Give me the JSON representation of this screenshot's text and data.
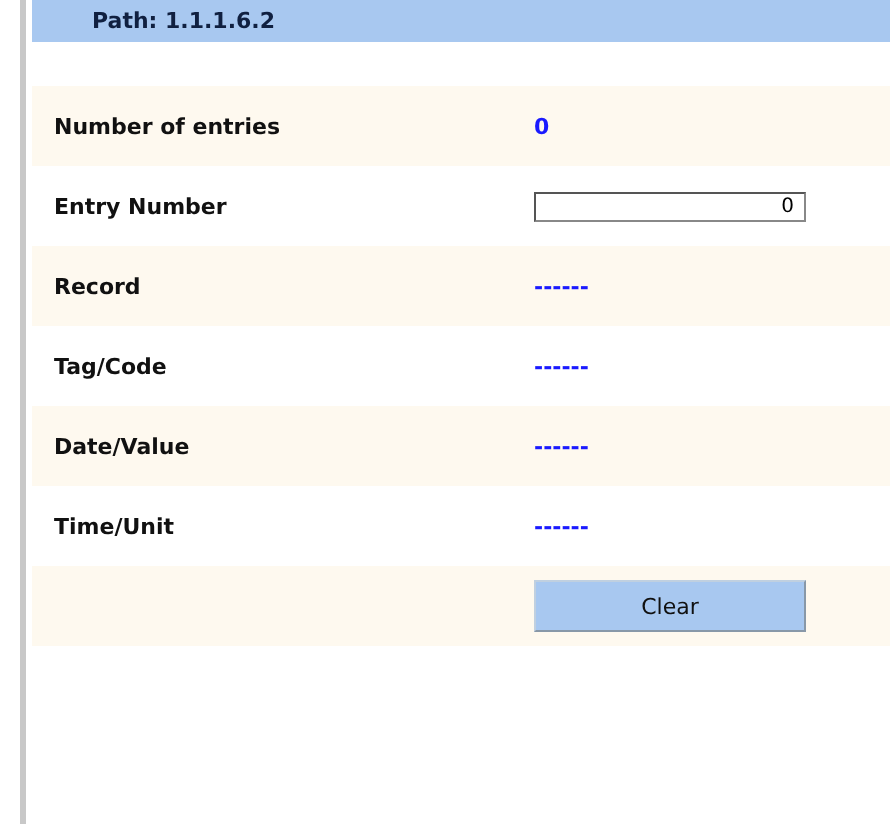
{
  "header": {
    "path": "Path:  1.1.1.6.2"
  },
  "rows": [
    {
      "kind": "text",
      "label": "Number of entries",
      "value": "0"
    },
    {
      "kind": "input",
      "label": "Entry Number",
      "value": "0"
    },
    {
      "kind": "text",
      "label": "Record",
      "value": "------"
    },
    {
      "kind": "text",
      "label": "Tag/Code",
      "value": "------"
    },
    {
      "kind": "text",
      "label": "Date/Value",
      "value": "------"
    },
    {
      "kind": "text",
      "label": "Time/Unit",
      "value": "------"
    },
    {
      "kind": "button",
      "label": "Clear"
    }
  ]
}
